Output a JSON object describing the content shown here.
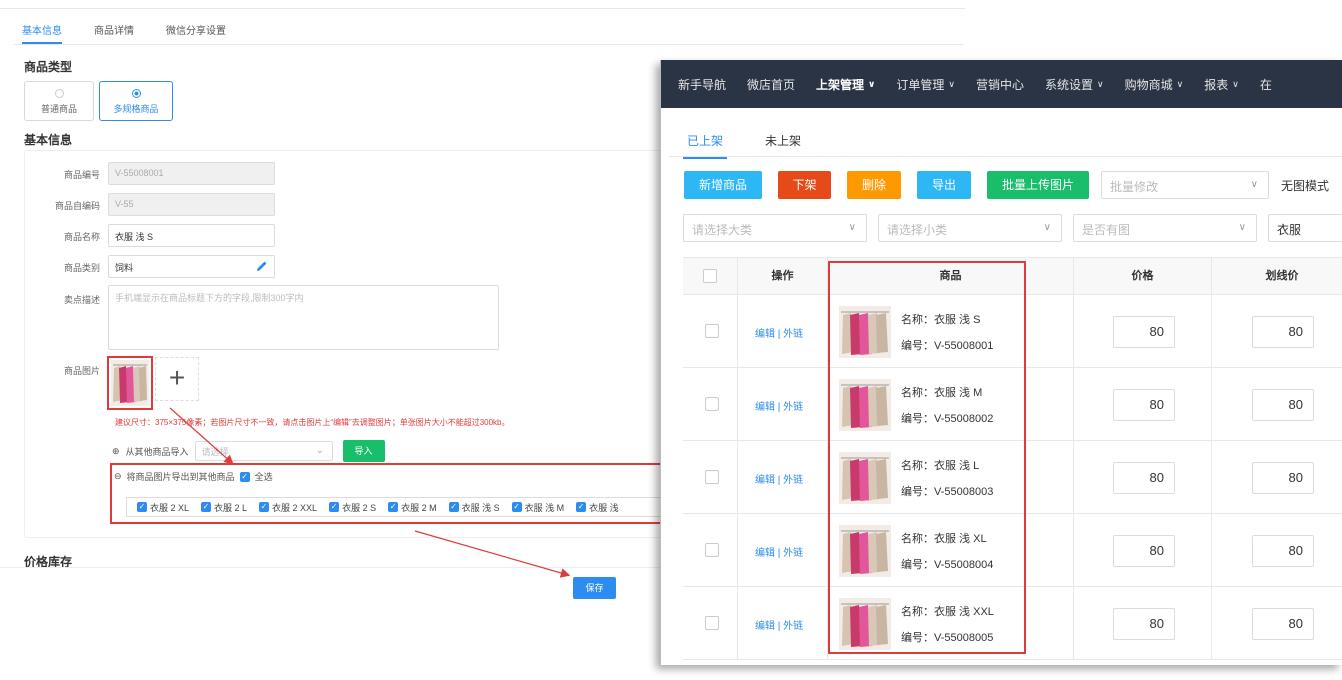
{
  "left": {
    "tabs": [
      "基本信息",
      "商品详情",
      "微信分享设置"
    ],
    "product_type_title": "商品类型",
    "type_options": [
      "普通商品",
      "多规格商品"
    ],
    "basic_info_title": "基本信息",
    "fields": {
      "code_label": "商品编号",
      "code_value": "V-55008001",
      "custom_code_label": "商品自编码",
      "custom_code_value": "V-55",
      "name_label": "商品名称",
      "name_value": "衣服 浅 S",
      "category_label": "商品类别",
      "category_value": "饲料",
      "desc_label": "卖点描述",
      "desc_placeholder": "手机端显示在商品标题下方的字段,限制300字内",
      "image_label": "商品图片"
    },
    "image_add": "+",
    "hint": "建议尺寸：375×375像素；若图片尺寸不一致，请点击图片上“编辑”去调整图片；单张图片大小不能超过300kb。",
    "import_label": "从其他商品导入",
    "import_placeholder": "请选择",
    "import_button": "导入",
    "export_label": "将商品图片导出到其他商品",
    "select_all": "全选",
    "export_items": [
      "衣服 2 XL",
      "衣服 2 L",
      "衣服 2 XXL",
      "衣服 2 S",
      "衣服 2 M",
      "衣服 浅 S",
      "衣服 浅 M",
      "衣服 浅"
    ],
    "price_stock_title": "价格库存",
    "save_button": "保存"
  },
  "right": {
    "nav": [
      {
        "label": "新手导航",
        "chevron": false
      },
      {
        "label": "微店首页",
        "chevron": false
      },
      {
        "label": "上架管理",
        "chevron": true,
        "active": true
      },
      {
        "label": "订单管理",
        "chevron": true
      },
      {
        "label": "营销中心",
        "chevron": false
      },
      {
        "label": "系统设置",
        "chevron": true
      },
      {
        "label": "购物商城",
        "chevron": true
      },
      {
        "label": "报表",
        "chevron": true
      },
      {
        "label": "在",
        "chevron": false
      }
    ],
    "tabs": [
      "已上架",
      "未上架"
    ],
    "buttons": [
      {
        "label": "新增商品",
        "color": "#2db7f5"
      },
      {
        "label": "下架",
        "color": "#e64a19"
      },
      {
        "label": "删除",
        "color": "#ff9900"
      },
      {
        "label": "导出",
        "color": "#2db7f5"
      },
      {
        "label": "批量上传图片",
        "color": "#19be6b"
      }
    ],
    "batch_edit_placeholder": "批量修改",
    "no_image_label": "无图模式",
    "filters": {
      "big_category": "请选择大类",
      "small_category": "请选择小类",
      "has_image": "是否有图",
      "keyword": "衣服"
    },
    "columns": [
      "操作",
      "商品",
      "价格",
      "划线价"
    ],
    "ops_text": "编辑 | 外链",
    "rows": [
      {
        "name": "名称：衣服 浅 S",
        "code": "编号：V-55008001",
        "price": "80",
        "strike": "80"
      },
      {
        "name": "名称：衣服 浅 M",
        "code": "编号：V-55008002",
        "price": "80",
        "strike": "80"
      },
      {
        "name": "名称：衣服 浅 L",
        "code": "编号：V-55008003",
        "price": "80",
        "strike": "80"
      },
      {
        "name": "名称：衣服 浅 XL",
        "code": "编号：V-55008004",
        "price": "80",
        "strike": "80"
      },
      {
        "name": "名称：衣服 浅 XXL",
        "code": "编号：V-55008005",
        "price": "80",
        "strike": "80"
      }
    ]
  },
  "colors": {
    "accent": "#2d8cf0",
    "highlight": "#e03b3b",
    "navbar": "#2a3444"
  }
}
